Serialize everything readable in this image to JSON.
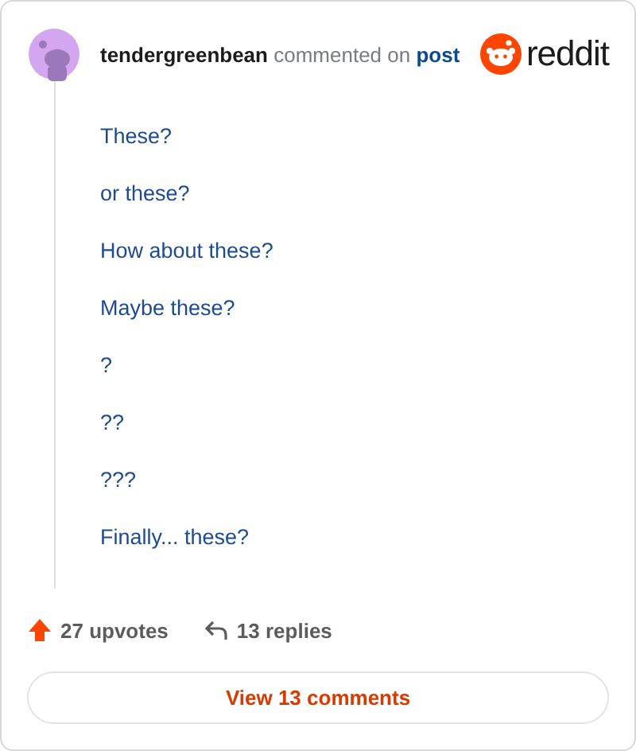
{
  "header": {
    "username": "tendergreenbean",
    "action": "commented on",
    "target": "post",
    "brand": "reddit"
  },
  "comment_lines": [
    "These?",
    "or these?",
    "How about these?",
    "Maybe these?",
    "?",
    "??",
    "???",
    "Finally... these?"
  ],
  "footer": {
    "upvotes": "27 upvotes",
    "replies": "13 replies",
    "view_button": "View 13 comments"
  }
}
